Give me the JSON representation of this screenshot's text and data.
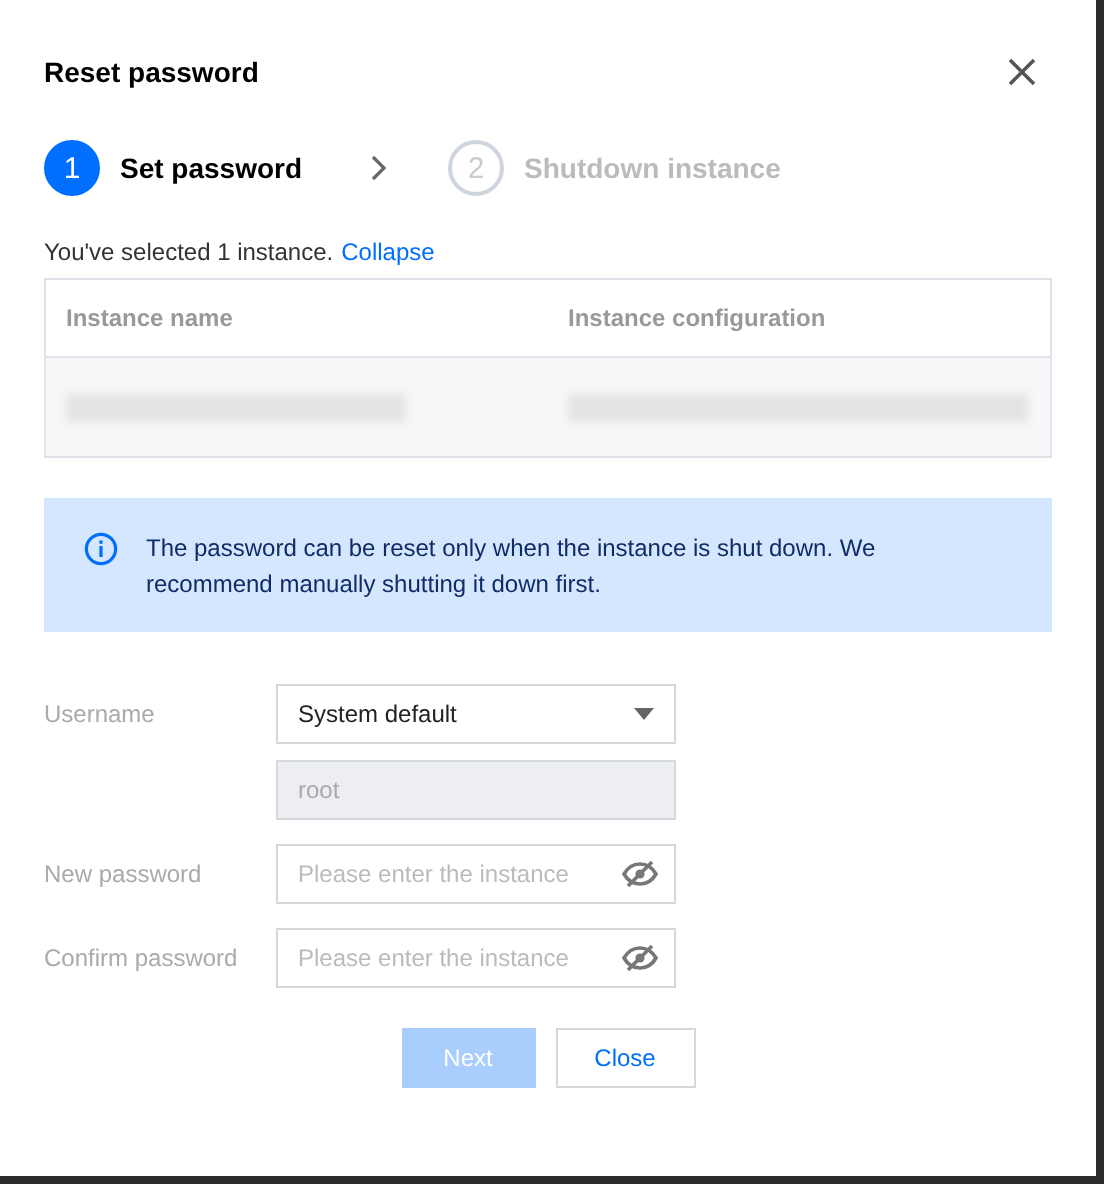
{
  "dialog": {
    "title": "Reset password"
  },
  "steps": [
    {
      "number": "1",
      "label": "Set password",
      "selected": true
    },
    {
      "number": "2",
      "label": "Shutdown instance",
      "selected": false
    }
  ],
  "selection": {
    "text": "You've selected 1 instance.",
    "link": "Collapse"
  },
  "table": {
    "columns": [
      "Instance name",
      "Instance configuration"
    ]
  },
  "notice": {
    "text": "The password can be reset only when the instance is shut down. We recommend manually shutting it down first."
  },
  "form": [
    {
      "kind": "select",
      "label": "Username",
      "value": "System default",
      "sub_value": "root"
    },
    {
      "kind": "password",
      "label": "New password",
      "placeholder": "Please enter the instance"
    },
    {
      "kind": "password",
      "label": "Confirm password",
      "placeholder": "Please enter the instance"
    }
  ],
  "buttons": [
    {
      "label": "Next",
      "kind": "primary",
      "disabled": true
    },
    {
      "label": "Close",
      "kind": "secondary",
      "disabled": false
    }
  ]
}
